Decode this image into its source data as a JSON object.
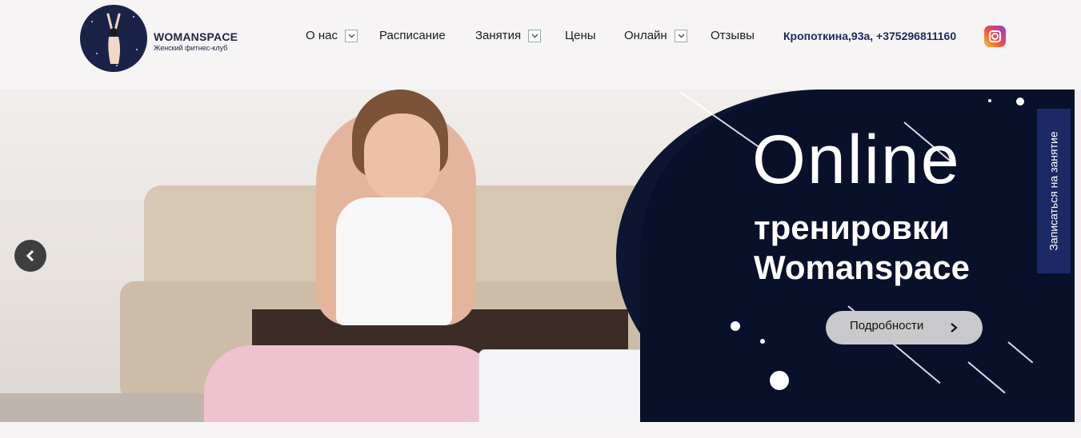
{
  "header": {
    "brand_name": "WOMANSPACE",
    "brand_tagline": "Женский фитнес-клуб",
    "nav": [
      {
        "label": "О нас",
        "has_dropdown": true
      },
      {
        "label": "Расписание",
        "has_dropdown": false
      },
      {
        "label": "Занятия",
        "has_dropdown": true
      },
      {
        "label": "Цены",
        "has_dropdown": false
      },
      {
        "label": "Онлайн",
        "has_dropdown": true
      },
      {
        "label": "Отзывы",
        "has_dropdown": false
      }
    ],
    "contact": "Кропоткина,93а, +375296811160",
    "social_icon": "instagram-icon"
  },
  "hero": {
    "heading": "Online",
    "subheading_line1": "тренировки",
    "subheading_line2": "Womanspace",
    "cta_label": "Подробности",
    "side_cta_label": "Записаться на занятие",
    "prev_icon": "chevron-left-icon"
  },
  "colors": {
    "panel": "#0d1530",
    "side_button": "#1b2a66",
    "cta_bg": "#c9c9cc",
    "brand_text": "#23263f",
    "contact_text": "#1c2a55"
  }
}
